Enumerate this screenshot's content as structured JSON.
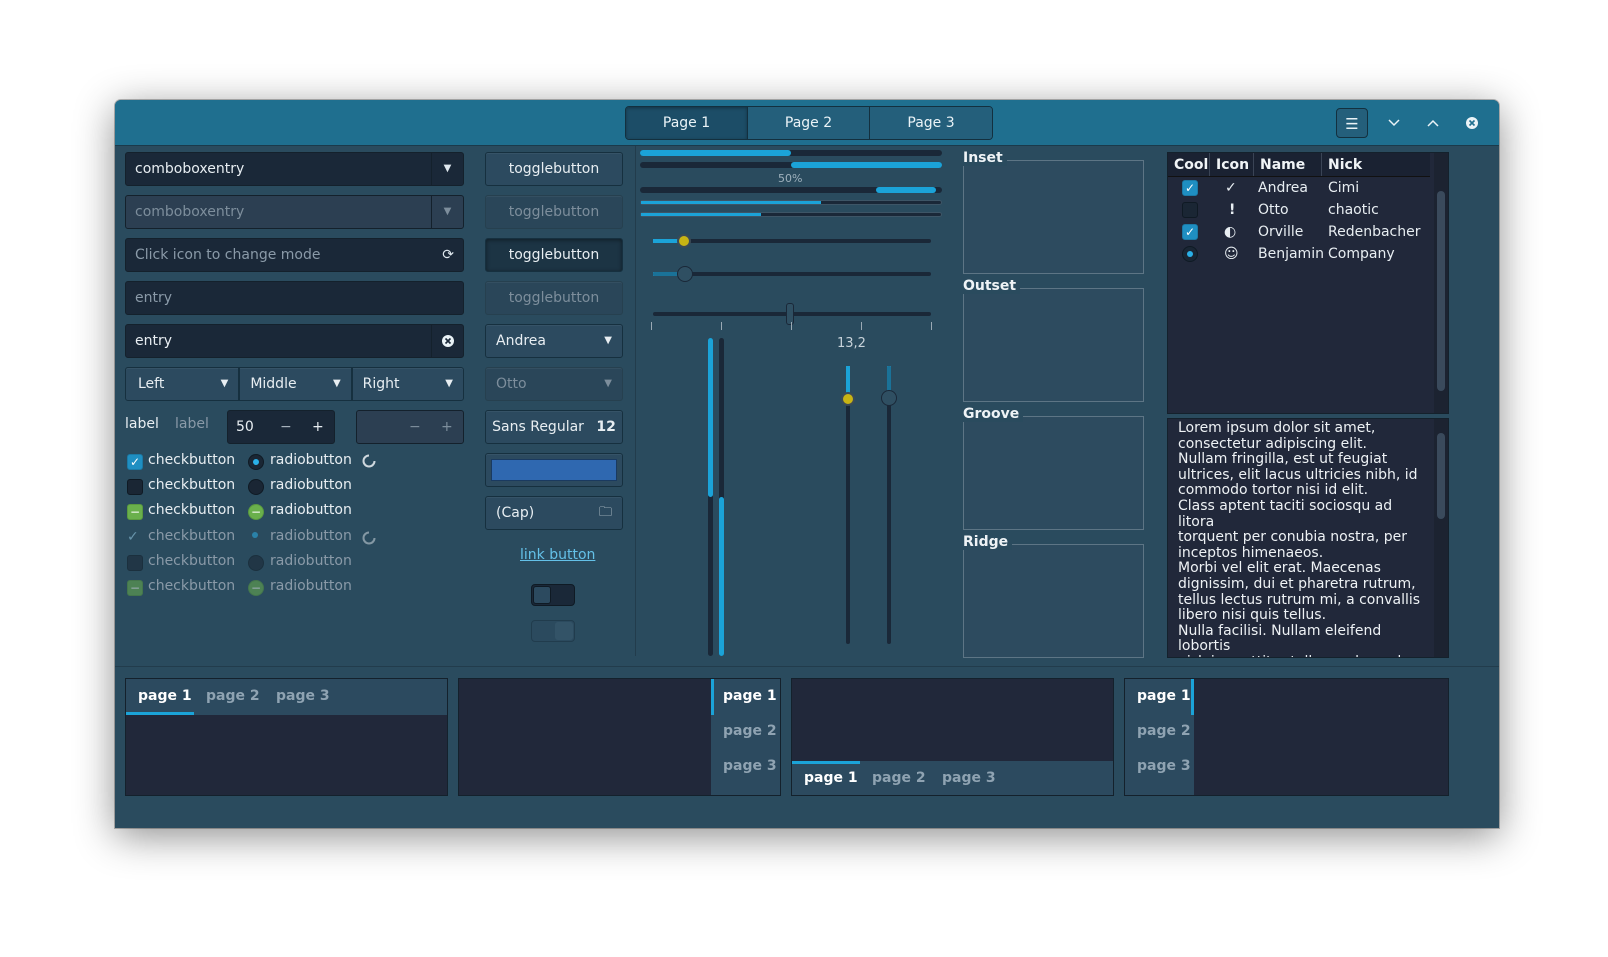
{
  "header": {
    "stack_pages": [
      "Page 1",
      "Page 2",
      "Page 3"
    ],
    "menu_icon": "hamburger-icon",
    "minimize_icon": "chevron-down-icon",
    "maximize_icon": "chevron-up-icon",
    "close_icon": "close-icon"
  },
  "left": {
    "combo1_value": "comboboxentry",
    "combo2_value": "comboboxentry",
    "entry_mode_placeholder": "Click icon to change mode",
    "entry_plain": "entry",
    "entry_clear": "entry",
    "segmented": [
      "Left",
      "Middle",
      "Right"
    ],
    "label1": "label",
    "label2": "label",
    "spin_value": "50",
    "spin_minus": "−",
    "spin_plus": "+",
    "checkbutton": "checkbutton",
    "radiobutton": "radiobutton"
  },
  "buttons": {
    "toggle": "togglebutton",
    "combo_active": "Andrea",
    "combo_inactive": "Otto",
    "font_name": "Sans Regular",
    "font_size": "12",
    "file_chooser": "(Cap)",
    "link": "link button"
  },
  "sliders": {
    "progress_text": "50%",
    "scale_value": "13,2",
    "progress_level": 0.5
  },
  "frames": [
    "Inset",
    "Outset",
    "Groove",
    "Ridge"
  ],
  "tree": {
    "columns": [
      "Cool",
      "Icon",
      "Name",
      "Nick"
    ],
    "rows": [
      {
        "cool": "checked",
        "icon": "checkmark-icon",
        "name": "Andrea",
        "nick": "Cimi"
      },
      {
        "cool": "unchecked",
        "icon": "exclamation-icon",
        "name": "Otto",
        "nick": "chaotic"
      },
      {
        "cool": "checked",
        "icon": "moon-icon",
        "name": "Orville",
        "nick": "Redenbacher"
      },
      {
        "cool": "radio",
        "icon": "face-icon",
        "name": "Benjamin",
        "nick": "Company"
      }
    ]
  },
  "textview": {
    "text": "Lorem ipsum dolor sit amet,\nconsectetur adipiscing elit.\nNullam fringilla, est ut feugiat\nultrices, elit lacus ultricies nibh, id\ncommodo tortor nisi id elit.\nClass aptent taciti sociosqu ad litora\ntorquent per conubia nostra, per\ninceptos himenaeos.\nMorbi vel elit erat. Maecenas\ndignissim, dui et pharetra rutrum,\ntellus lectus rutrum mi, a convallis\nlibero nisi quis tellus.\nNulla facilisi. Nullam eleifend lobortis\nnisl, in porttitor tellus malesuada\nvitae."
  },
  "notebook_tabs": [
    "page 1",
    "page 2",
    "page 3"
  ]
}
